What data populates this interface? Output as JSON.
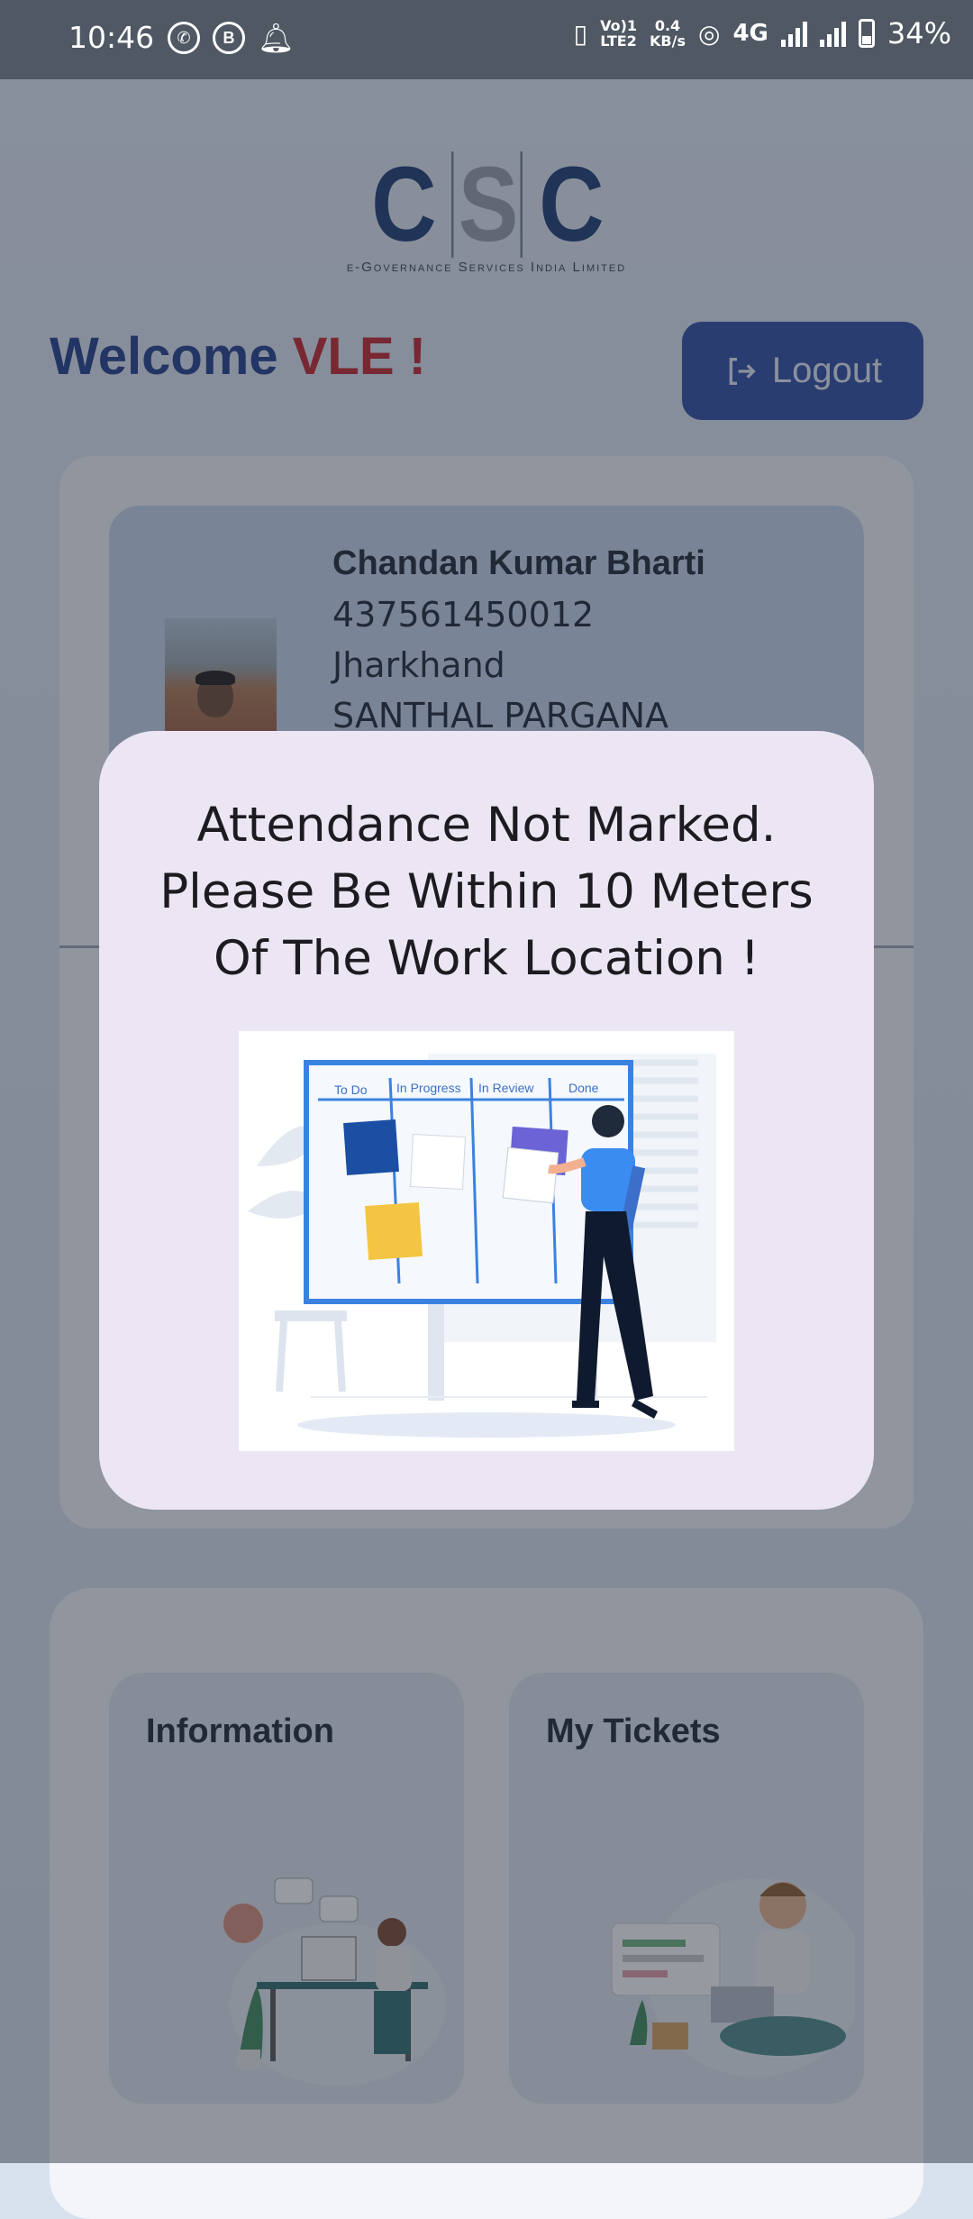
{
  "status_bar": {
    "time": "10:46",
    "left_icons": [
      "whatsapp-icon",
      "business-icon",
      "notification-bell-icon"
    ],
    "volte_label": "Vo)) 1\nLTE2",
    "speed_value": "0.4",
    "speed_unit": "KB/s",
    "network": "4G",
    "battery_percent": "34%"
  },
  "logo": {
    "letters": [
      "C",
      "S",
      "C"
    ],
    "subtitle": "e-Governance Services India Limited"
  },
  "header": {
    "welcome_text": "Welcome",
    "user_role": "VLE !",
    "logout_label": "Logout"
  },
  "profile": {
    "name": "Chandan Kumar Bharti",
    "id": "437561450012",
    "state": "Jharkhand",
    "region": "SANTHAL PARGANA"
  },
  "tiles": [
    {
      "label": "Information"
    },
    {
      "label": "My Tickets"
    }
  ],
  "dialog": {
    "message": "Attendance Not Marked. Please Be Within 10 Meters Of The Work Location !",
    "illustration_columns": [
      "To Do",
      "In Progress",
      "In Review",
      "Done"
    ]
  },
  "colors": {
    "brand_blue": "#223f8a",
    "brand_red": "#c4262b",
    "logout_bg": "#2c4ea3",
    "dialog_bg": "#ece6f4"
  }
}
